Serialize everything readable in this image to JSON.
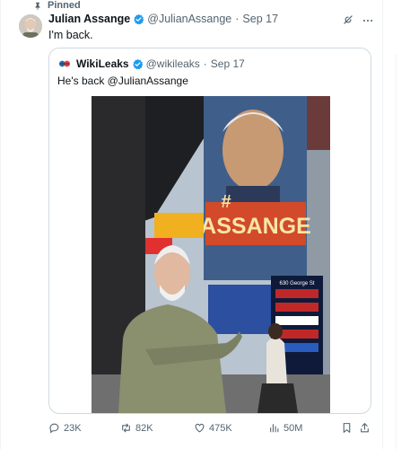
{
  "pinned": {
    "label": "Pinned"
  },
  "tweet": {
    "author_name": "Julian Assange",
    "handle": "@JulianAssange",
    "date": "Sep 17",
    "text": "I'm back."
  },
  "quote": {
    "author_name": "WikiLeaks",
    "handle": "@wikileaks",
    "date": "Sep 17",
    "text": "He's back @JulianAssange",
    "image": {
      "billboard_text": "ASSANGE",
      "billboard_hash": "#",
      "street_sign": "630 George St"
    }
  },
  "actions": {
    "replies": "23K",
    "reposts": "82K",
    "likes": "475K",
    "views": "50M"
  },
  "colors": {
    "text_primary": "#0f1419",
    "text_secondary": "#536471",
    "verified_blue": "#1d9bf0",
    "border": "#cfd9de"
  },
  "icons": {
    "pin": "pin-icon",
    "verified": "verified-badge-icon",
    "grok": "grok-icon",
    "more": "more-icon",
    "reply": "reply-icon",
    "repost": "repost-icon",
    "like": "heart-icon",
    "views": "views-icon",
    "bookmark": "bookmark-icon",
    "share": "share-icon"
  }
}
